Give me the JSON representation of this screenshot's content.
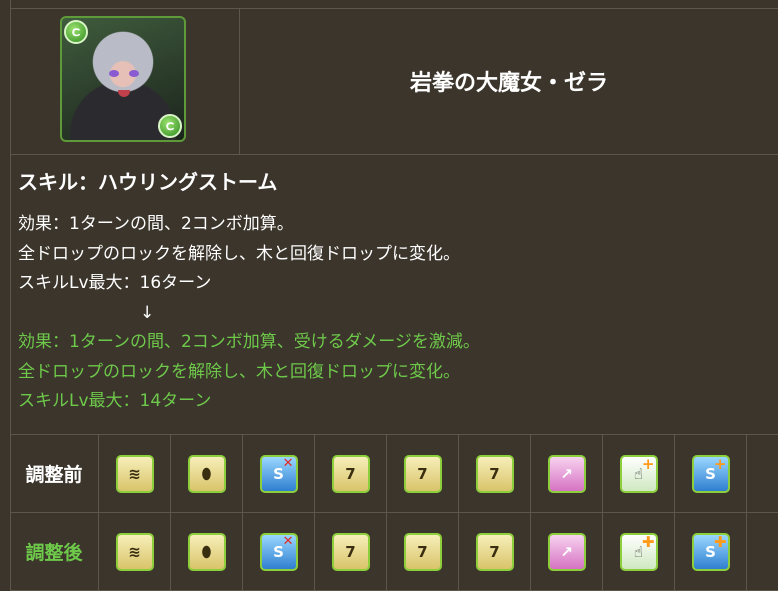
{
  "monster": {
    "name": "岩拳の大魔女・ゼラ",
    "portrait_icon": "monster-portrait-icon",
    "attribute_icon": "wood-attribute-icon",
    "attribute_color": "#5e9a39"
  },
  "skill": {
    "title": "スキル：ハウリングストーム",
    "before_lines": [
      "効果：1ターンの間、2コンボ加算。",
      "全ドロップのロックを解除し、木と回復ドロップに変化。",
      "スキルLv最大：16ターン"
    ],
    "arrow": "↓",
    "after_lines": [
      "効果：1ターンの間、2コンボ加算、受けるダメージを激減。",
      "全ドロップのロックを解除し、木と回復ドロップに変化。",
      "スキルLv最大：14ターン"
    ],
    "after_color": "#6ec94a"
  },
  "awakenings": {
    "before_label": "調整前",
    "after_label": "調整後",
    "before": [
      "status-downgrade-resistance-icon",
      "damage-reduction-icon",
      "unbind-negation-icon",
      "seven-combo-icon",
      "seven-combo-icon",
      "seven-combo-icon",
      "sub-attribute-icon",
      "extend-time-icon",
      "skill-boost-icon"
    ],
    "after": [
      "status-downgrade-resistance-icon",
      "damage-reduction-icon",
      "unbind-negation-icon",
      "seven-combo-icon",
      "seven-combo-icon",
      "seven-combo-icon",
      "sub-attribute-icon",
      "extend-time-plus-icon",
      "skill-boost-plus-icon"
    ]
  }
}
